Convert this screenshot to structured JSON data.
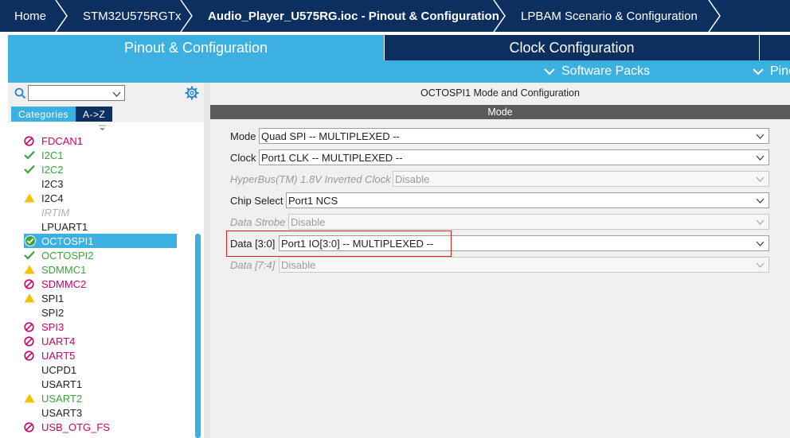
{
  "breadcrumb": {
    "items": [
      "Home",
      "STM32U575RGTx",
      "Audio_Player_U575RG.ioc - Pinout & Configuration",
      "LPBAM Scenario & Configuration"
    ]
  },
  "tabs": {
    "pinout": "Pinout & Configuration",
    "clock": "Clock Configuration"
  },
  "subtabs": {
    "software_packs": "Software Packs",
    "pinout": "Pinout"
  },
  "left": {
    "search": {
      "value": ""
    },
    "category_tabs": {
      "categories": "Categories",
      "az": "A->Z"
    },
    "peripherals": [
      {
        "name": "FDCAN1",
        "status": "disabled",
        "color": "#cc0066"
      },
      {
        "name": "I2C1",
        "status": "ok",
        "color": "#3aa63a"
      },
      {
        "name": "I2C2",
        "status": "ok",
        "color": "#3aa63a"
      },
      {
        "name": "I2C3",
        "status": "none",
        "color": "#222222"
      },
      {
        "name": "I2C4",
        "status": "warning",
        "color": "#222222"
      },
      {
        "name": "IRTIM",
        "status": "unavailable",
        "color": "#b0b0b0"
      },
      {
        "name": "LPUART1",
        "status": "none",
        "color": "#222222"
      },
      {
        "name": "OCTOSPI1",
        "status": "selected",
        "color": "#ffffff"
      },
      {
        "name": "OCTOSPI2",
        "status": "ok",
        "color": "#3aa63a"
      },
      {
        "name": "SDMMC1",
        "status": "warning",
        "color": "#3aa63a"
      },
      {
        "name": "SDMMC2",
        "status": "disabled",
        "color": "#cc0066"
      },
      {
        "name": "SPI1",
        "status": "warning",
        "color": "#222222"
      },
      {
        "name": "SPI2",
        "status": "none",
        "color": "#222222"
      },
      {
        "name": "SPI3",
        "status": "disabled",
        "color": "#cc0066"
      },
      {
        "name": "UART4",
        "status": "disabled",
        "color": "#cc0066"
      },
      {
        "name": "UART5",
        "status": "disabled",
        "color": "#cc0066"
      },
      {
        "name": "UCPD1",
        "status": "none",
        "color": "#222222"
      },
      {
        "name": "USART1",
        "status": "none",
        "color": "#222222"
      },
      {
        "name": "USART2",
        "status": "warning",
        "color": "#3aa63a"
      },
      {
        "name": "USART3",
        "status": "none",
        "color": "#222222"
      },
      {
        "name": "USB_OTG_FS",
        "status": "disabled",
        "color": "#cc0066"
      }
    ]
  },
  "right": {
    "title": "OCTOSPI1 Mode and Configuration",
    "mode_header": "Mode",
    "fields": [
      {
        "label": "Mode",
        "value": "Quad SPI -- MULTIPLEXED --",
        "disabled": false
      },
      {
        "label": "Clock",
        "value": "Port1 CLK -- MULTIPLEXED --",
        "disabled": false
      },
      {
        "label": "HyperBus(TM) 1.8V Inverted Clock",
        "value": "Disable",
        "disabled": true
      },
      {
        "label": "Chip Select",
        "value": "Port1 NCS",
        "disabled": false
      },
      {
        "label": "Data Strobe",
        "value": "Disable",
        "disabled": true
      },
      {
        "label": "Data [3:0]",
        "value": "Port1 IO[3:0] -- MULTIPLEXED --",
        "disabled": false
      },
      {
        "label": "Data [7:4]",
        "value": "Disable",
        "disabled": true
      }
    ]
  },
  "colors": {
    "navy": "#0c2f60",
    "accent": "#3cb1e1",
    "highlight": "#d9231f"
  }
}
